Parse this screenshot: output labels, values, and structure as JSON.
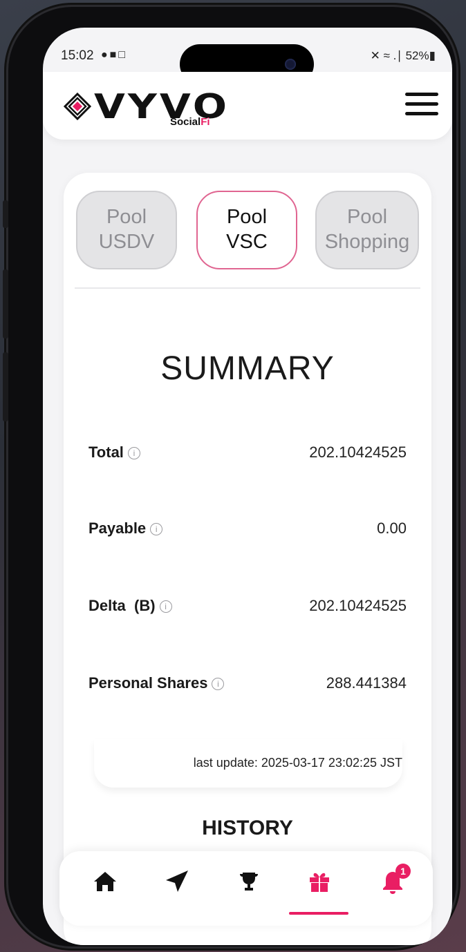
{
  "status_bar": {
    "time": "15:02",
    "left_icons": "●■□",
    "right_text": "✕ ≈ .∣ 52%▮"
  },
  "header": {
    "logo_text": "VYVO",
    "logo_sub_1": "Social",
    "logo_sub_2": "Fi",
    "menu_icon": "hamburger-menu-icon"
  },
  "tabs": [
    {
      "line1": "Pool",
      "line2": "USDV",
      "active": false
    },
    {
      "line1": "Pool",
      "line2": "VSC",
      "active": true
    },
    {
      "line1": "Pool",
      "line2": "Shopping",
      "active": false
    }
  ],
  "summary": {
    "title": "SUMMARY",
    "rows": [
      {
        "label": "Total",
        "value": "202.10424525"
      },
      {
        "label": "Payable",
        "value": "0.00"
      },
      {
        "label": "Delta  (B)",
        "value": "202.10424525"
      },
      {
        "label": "Personal Shares",
        "value": "288.441384"
      }
    ],
    "info_glyph": "i",
    "last_update": "last update: 2025-03-17 23:02:25 JST"
  },
  "history": {
    "title": "HISTORY"
  },
  "bottom_nav": {
    "items": [
      "home-icon",
      "send-icon",
      "trophy-icon",
      "gift-icon",
      "bell-icon"
    ],
    "active": "gift-icon",
    "notification_count": "1",
    "accent_color": "#e91e63"
  }
}
